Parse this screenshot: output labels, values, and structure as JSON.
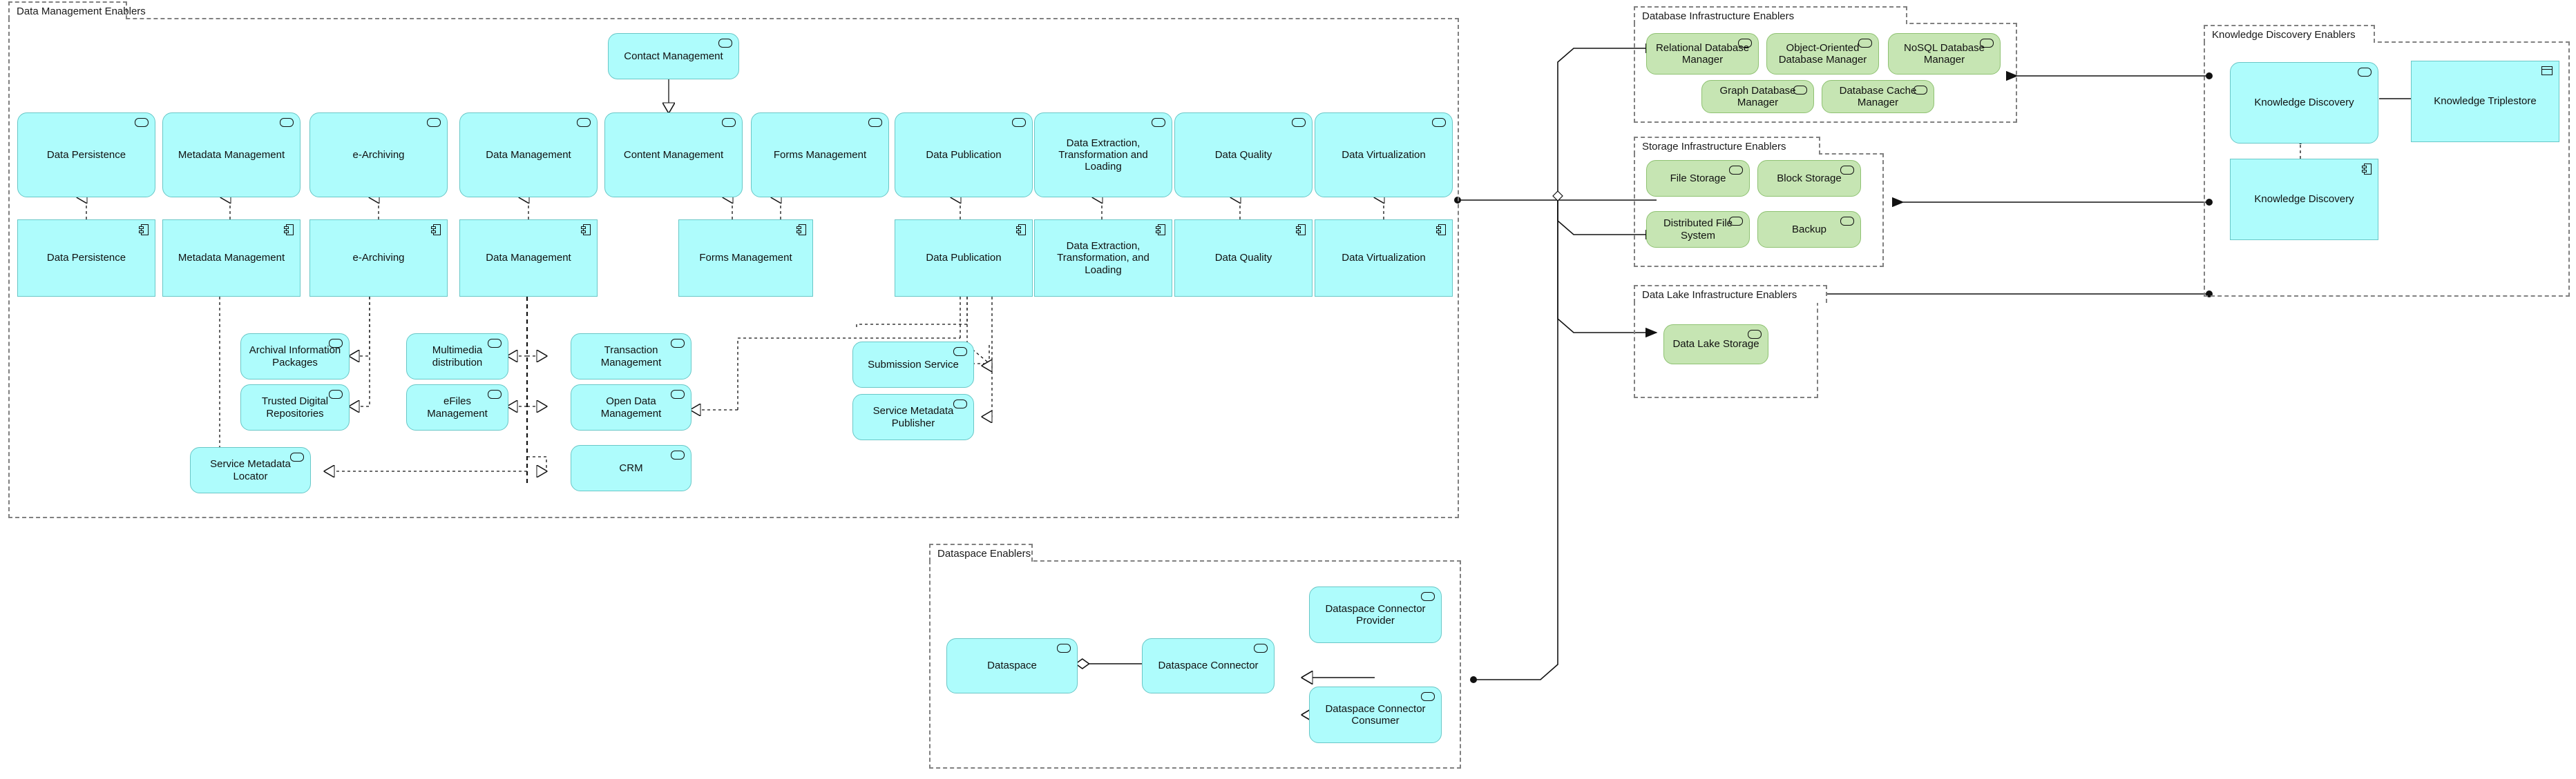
{
  "diagram": {
    "title": "Data Management Enablers Architecture",
    "colors": {
      "service_fill": "#aefcfc",
      "service_stroke": "#69c7c7",
      "tech_fill": "#c6e5b3",
      "tech_stroke": "#8fc272",
      "group_border": "#808080",
      "line": "#000000"
    }
  },
  "groups": [
    {
      "id": "data-management-enablers",
      "label": "Data Management Enablers"
    },
    {
      "id": "database-infrastructure-enablers",
      "label": "Database Infrastructure Enablers"
    },
    {
      "id": "storage-infrastructure-enablers",
      "label": "Storage Infrastructure Enablers"
    },
    {
      "id": "data-lake-infrastructure-enablers",
      "label": "Data Lake Infrastructure Enablers"
    },
    {
      "id": "knowledge-discovery-enablers",
      "label": "Knowledge Discovery Enablers"
    },
    {
      "id": "dataspace-enablers",
      "label": "Dataspace Enablers"
    }
  ],
  "nodes": {
    "contact_management": {
      "label": "Contact Management",
      "icon": "application-service-icon"
    },
    "svc_data_persistence": {
      "label": "Data Persistence",
      "icon": "application-service-icon"
    },
    "svc_metadata_management": {
      "label": "Metadata Management",
      "icon": "application-service-icon"
    },
    "svc_e_archiving": {
      "label": "e-Archiving",
      "icon": "application-service-icon"
    },
    "svc_data_management": {
      "label": "Data Management",
      "icon": "application-service-icon"
    },
    "svc_content_management": {
      "label": "Content Management",
      "icon": "application-service-icon"
    },
    "svc_forms_management": {
      "label": "Forms Management",
      "icon": "application-service-icon"
    },
    "svc_data_publication": {
      "label": "Data Publication",
      "icon": "application-service-icon"
    },
    "svc_detl": {
      "label": "Data Extraction, Transformation and Loading",
      "icon": "application-service-icon"
    },
    "svc_data_quality": {
      "label": "Data Quality",
      "icon": "application-service-icon"
    },
    "svc_data_virtualization": {
      "label": "Data Virtualization",
      "icon": "application-service-icon"
    },
    "cmp_data_persistence": {
      "label": "Data Persistence",
      "icon": "application-component-icon"
    },
    "cmp_metadata_management": {
      "label": "Metadata Management",
      "icon": "application-component-icon"
    },
    "cmp_e_archiving": {
      "label": "e-Archiving",
      "icon": "application-component-icon"
    },
    "cmp_data_management": {
      "label": "Data Management",
      "icon": "application-component-icon"
    },
    "cmp_forms_management": {
      "label": "Forms Management",
      "icon": "application-component-icon"
    },
    "cmp_data_publication": {
      "label": "Data Publication",
      "icon": "application-component-icon"
    },
    "cmp_detl": {
      "label": "Data Extraction, Transformation, and Loading",
      "icon": "application-component-icon"
    },
    "cmp_data_quality": {
      "label": "Data Quality",
      "icon": "application-component-icon"
    },
    "cmp_data_virtualization": {
      "label": "Data Virtualization",
      "icon": "application-component-icon"
    },
    "aip": {
      "label": "Archival Information Packages",
      "icon": "application-service-icon"
    },
    "tdr": {
      "label": "Trusted Digital Repositories",
      "icon": "application-service-icon"
    },
    "multimedia_distribution": {
      "label": "Multimedia distribution",
      "icon": "application-service-icon"
    },
    "efiles_management": {
      "label": "eFiles Management",
      "icon": "application-service-icon"
    },
    "transaction_management": {
      "label": "Transaction Management",
      "icon": "application-service-icon"
    },
    "open_data_management": {
      "label": "Open Data Management",
      "icon": "application-service-icon"
    },
    "crm": {
      "label": "CRM",
      "icon": "application-service-icon"
    },
    "service_metadata_locator": {
      "label": "Service Metadata Locator",
      "icon": "application-service-icon"
    },
    "submission_service": {
      "label": "Submission Service",
      "icon": "application-service-icon"
    },
    "service_metadata_publisher": {
      "label": "Service Metadata Publisher",
      "icon": "application-service-icon"
    },
    "relational_db_manager": {
      "label": "Relational Database Manager",
      "icon": "technology-service-icon"
    },
    "oo_db_manager": {
      "label": "Object-Oriented Database Manager",
      "icon": "technology-service-icon"
    },
    "nosql_db_manager": {
      "label": "NoSQL Database Manager",
      "icon": "technology-service-icon"
    },
    "graph_db_manager": {
      "label": "Graph Database Manager",
      "icon": "technology-service-icon"
    },
    "db_cache_manager": {
      "label": "Database Cache Manager",
      "icon": "technology-service-icon"
    },
    "file_storage": {
      "label": "File Storage",
      "icon": "technology-service-icon"
    },
    "block_storage": {
      "label": "Block Storage",
      "icon": "technology-service-icon"
    },
    "distributed_file_system": {
      "label": "Distributed File System",
      "icon": "technology-service-icon"
    },
    "backup": {
      "label": "Backup",
      "icon": "technology-service-icon"
    },
    "data_lake_storage": {
      "label": "Data Lake Storage",
      "icon": "technology-service-icon"
    },
    "svc_knowledge_discovery": {
      "label": "Knowledge Discovery",
      "icon": "application-service-icon"
    },
    "cmp_knowledge_discovery": {
      "label": "Knowledge Discovery",
      "icon": "application-component-icon"
    },
    "knowledge_triplestore": {
      "label": "Knowledge Triplestore",
      "icon": "data-object-icon"
    },
    "dataspace": {
      "label": "Dataspace",
      "icon": "application-service-icon"
    },
    "dataspace_connector": {
      "label": "Dataspace Connector",
      "icon": "application-service-icon"
    },
    "dataspace_connector_provider": {
      "label": "Dataspace Connector Provider",
      "icon": "application-service-icon"
    },
    "dataspace_connector_consumer": {
      "label": "Dataspace Connector Consumer",
      "icon": "application-service-icon"
    }
  }
}
